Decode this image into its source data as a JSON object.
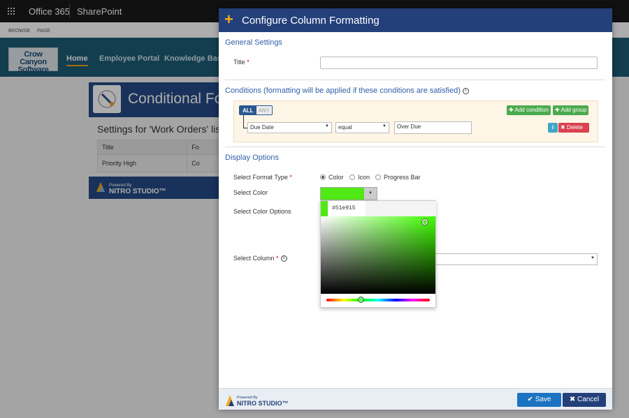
{
  "suitebar": {
    "app": "Office 365",
    "product": "SharePoint"
  },
  "ribbon": {
    "browse": "BROWSE",
    "page": "PAGE"
  },
  "site": {
    "logo_line1": "Crow Canyon",
    "logo_line2": "Software",
    "nav": [
      "Home",
      "Employee Portal",
      "Knowledge Base"
    ]
  },
  "background": {
    "app_title": "Conditional Fo",
    "settings_title": "Settings for 'Work Orders' list",
    "table_headers": [
      "Title",
      "Fo"
    ],
    "table_rows": [
      [
        "Priority High",
        "Co"
      ]
    ],
    "powered_by": "Powered By",
    "nitro": "NITRO STUDIO™"
  },
  "dialog": {
    "title": "Configure Column Formatting",
    "general_settings": "General Settings",
    "title_label": "Title",
    "title_value": "",
    "conditions_title": "Conditions (formatting will be applied if these conditions are satisfied)",
    "toggle_all": "ALL",
    "toggle_any": "ANY",
    "add_condition": "Add condition",
    "add_group": "Add group",
    "condition": {
      "field": "Due Date",
      "operator": "equal",
      "value": "Over Due"
    },
    "delete": "Delete",
    "display_options": "Display Options",
    "format_type_label": "Select Format Type",
    "format_types": [
      "Color",
      "Icon",
      "Progress Bar"
    ],
    "selected_format_type": "Color",
    "select_color_label": "Select Color",
    "color_options_label": "Select Color Options",
    "select_column_label": "Select Column",
    "color_hex": "#51e915",
    "selected_color": "#51e915",
    "footer_powered_by": "Powered By",
    "footer_nitro": "NITRO STUDIO™",
    "save": "Save",
    "cancel": "Cancel"
  },
  "colors": {
    "header_blue": "#23407a",
    "site_nav": "#1d5c75",
    "save_blue": "#1b73c2",
    "green_button": "#4caa4e",
    "red_button": "#d9424f",
    "accent_orange": "#f2a81d"
  }
}
